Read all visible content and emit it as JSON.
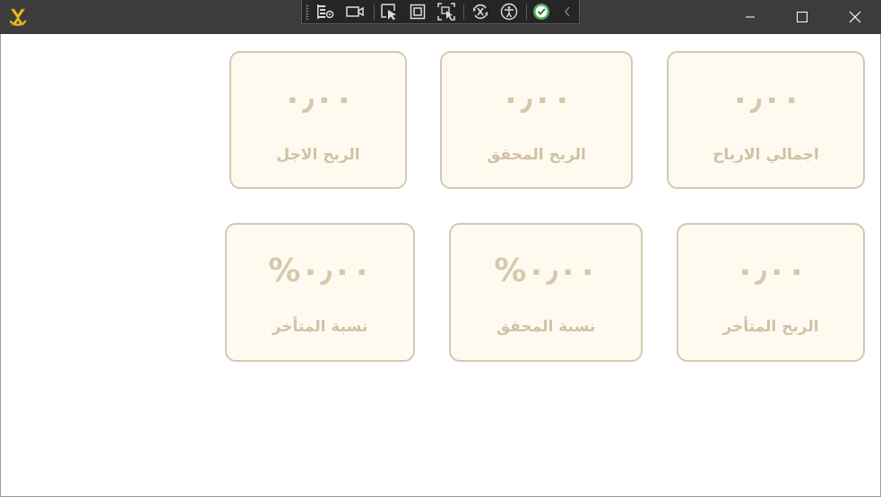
{
  "window": {
    "app_icon": "yellow-app-icon",
    "controls": {
      "minimize": "minimize-icon",
      "maximize": "maximize-icon",
      "close": "close-icon"
    }
  },
  "debug_toolbar": {
    "buttons": [
      "live-visual-tree-icon",
      "record-icon",
      "select-element-icon",
      "display-layout-adorners-icon",
      "track-focus-icon",
      "hot-reload-icon",
      "accessibility-icon",
      "binding-check-icon",
      "collapse-toolbar-icon"
    ]
  },
  "colors": {
    "card_background": "#fffaf0",
    "card_border": "#d3c9b3",
    "card_text": "#d6c9ab"
  },
  "cards": [
    {
      "value": "٠٫٠٠",
      "label": "اجمالي الارباح"
    },
    {
      "value": "٠٫٠٠",
      "label": "الربح المحقق"
    },
    {
      "value": "٠٫٠٠",
      "label": "الربح الاجل"
    },
    {
      "value": "٠٫٠٠",
      "label": "الربح المتأخر"
    },
    {
      "value": "٠٫٠٠%",
      "label": "نسبة المحقق"
    },
    {
      "value": "٠٫٠٠%",
      "label": "نسبة المتأخر"
    }
  ]
}
